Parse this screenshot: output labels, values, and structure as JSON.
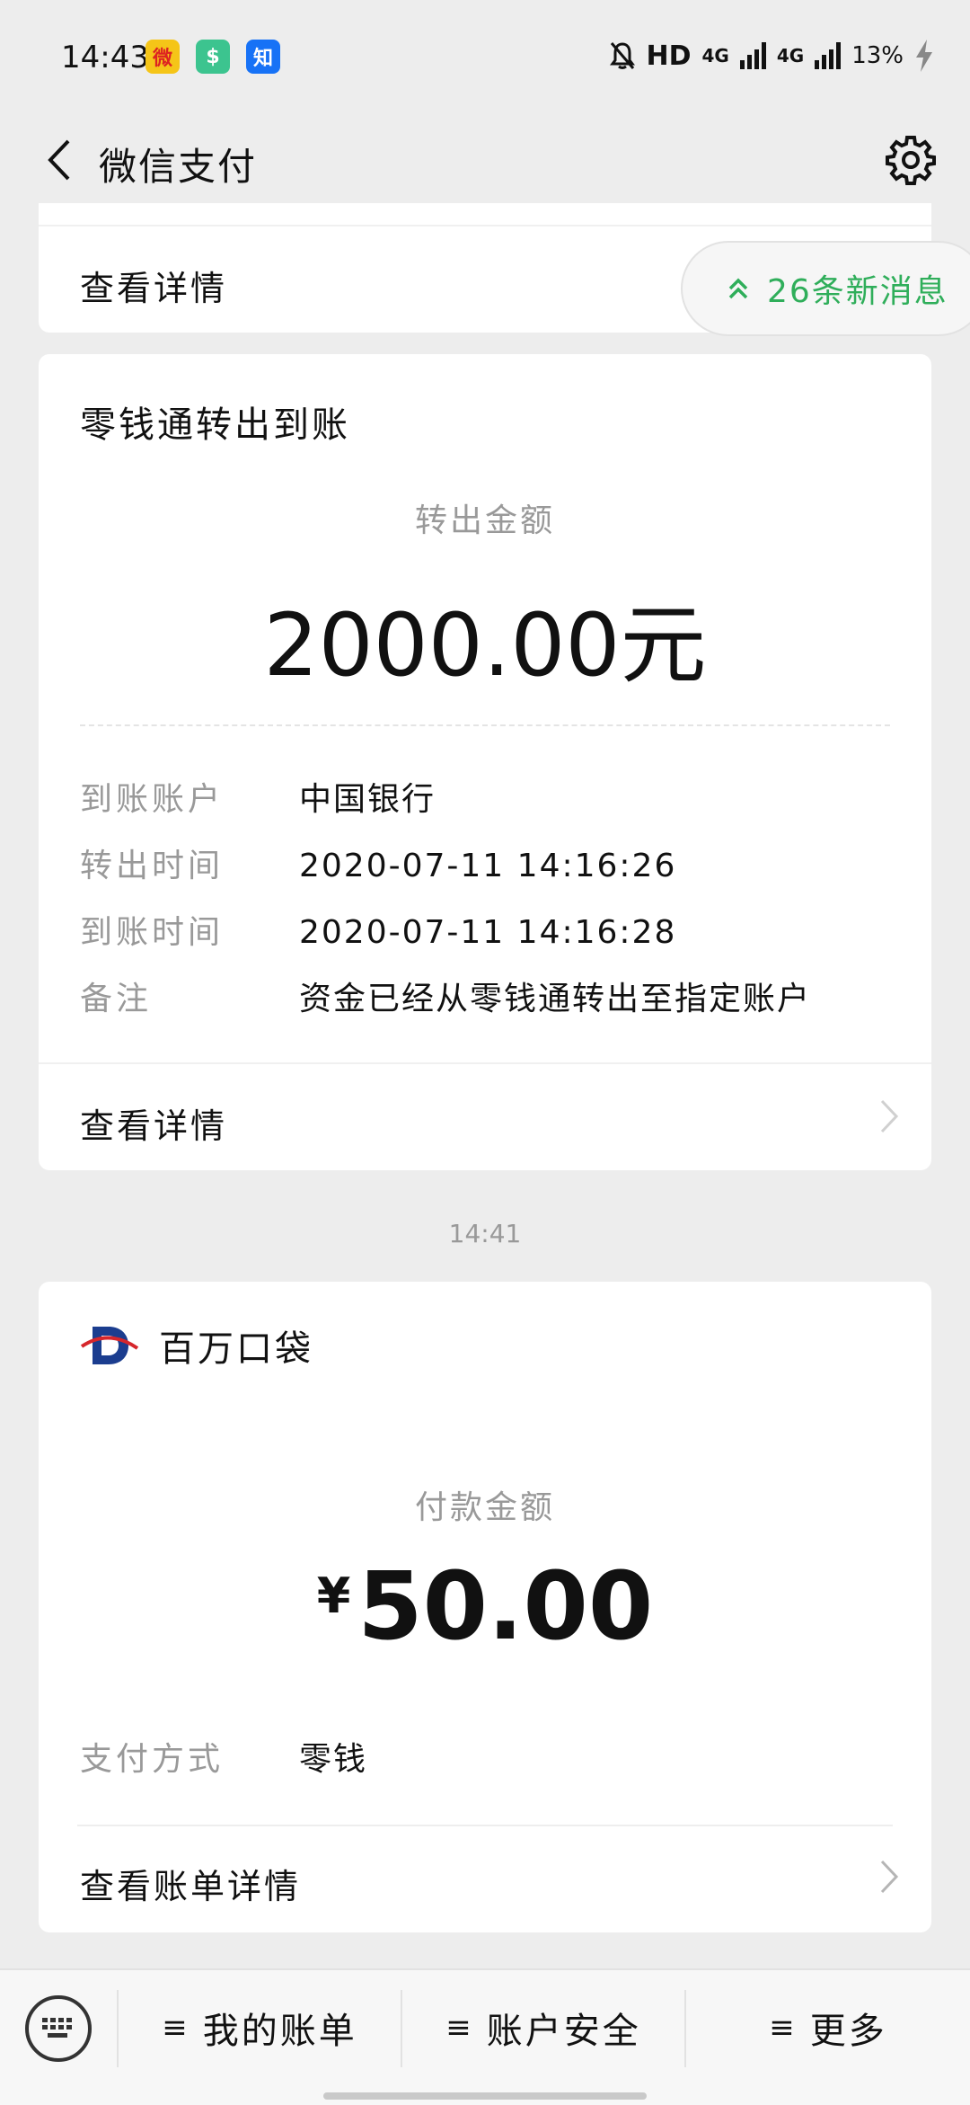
{
  "status_bar": {
    "time": "14:43",
    "app_icons": [
      {
        "name": "weibo-icon",
        "color": "#f5c518",
        "glyph": "微"
      },
      {
        "name": "shield-app-icon",
        "color": "#3cc48f",
        "glyph": "$"
      },
      {
        "name": "zhihu-icon",
        "color": "#1772f6",
        "glyph": "知"
      }
    ],
    "hd_label": "HD",
    "net1": "4G",
    "net2": "4G",
    "battery": "13%"
  },
  "header": {
    "title": "微信支付"
  },
  "top_card": {
    "link_label": "查看详情"
  },
  "new_messages": {
    "label": "26条新消息",
    "accent": "#2fae5a"
  },
  "transfer_card": {
    "title": "零钱通转出到账",
    "amount_label": "转出金额",
    "amount": "2000.00元",
    "rows": [
      {
        "key": "到账账户",
        "value": "中国银行"
      },
      {
        "key": "转出时间",
        "value": "2020-07-11 14:16:26"
      },
      {
        "key": "到账时间",
        "value": "2020-07-11 14:16:28"
      },
      {
        "key": "备注",
        "value": "资金已经从零钱通转出至指定账户"
      }
    ],
    "link_label": "查看详情"
  },
  "timestamp": "14:41",
  "payment_card": {
    "merchant": "百万口袋",
    "amount_label": "付款金额",
    "currency": "¥",
    "amount": "50.00",
    "rows": [
      {
        "key": "支付方式",
        "value": "零钱"
      }
    ],
    "link_label": "查看账单详情"
  },
  "bottom_bar": {
    "menus": [
      {
        "label": "我的账单"
      },
      {
        "label": "账户安全"
      },
      {
        "label": "更多"
      }
    ]
  }
}
